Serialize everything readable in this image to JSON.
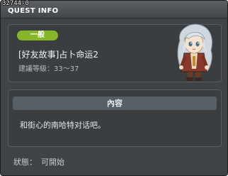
{
  "window": {
    "quest_id": "32744-0",
    "title": "QUEST INFO"
  },
  "quest": {
    "category": "一般",
    "name": "[好友故事]占卜命运2",
    "level_label": "建議等級：",
    "level_range": "33～37"
  },
  "content": {
    "header": "內容",
    "description": "和街心的南哈特对话吧。"
  },
  "status": {
    "label": "狀態：",
    "value": "可開始"
  },
  "colors": {
    "badge": "#88b629",
    "window_bg": "#3f4346",
    "header_bar": "#566066"
  },
  "icons": [
    "npc-portrait"
  ]
}
